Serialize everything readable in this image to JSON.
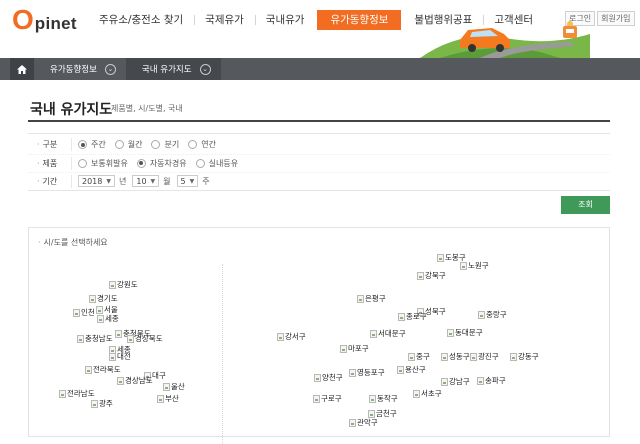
{
  "header": {
    "logo_initial": "O",
    "logo_rest": "pinet",
    "nav": [
      {
        "label": "주유소/충전소 찾기",
        "active": false
      },
      {
        "label": "국제유가",
        "active": false
      },
      {
        "label": "국내유가",
        "active": false
      },
      {
        "label": "유가동향정보",
        "active": true
      },
      {
        "label": "불법행위공표",
        "active": false
      },
      {
        "label": "고객센터",
        "active": false
      }
    ],
    "login": "로그인",
    "join": "회원가입"
  },
  "breadcrumb": {
    "items": [
      "유가동향정보",
      "국내 유가지도"
    ]
  },
  "page": {
    "title": "국내 유가지도",
    "subtitle": "제품별, 시/도별, 국내"
  },
  "form": {
    "period": {
      "label": "구분",
      "options": [
        {
          "label": "주간",
          "checked": true
        },
        {
          "label": "월간",
          "checked": false
        },
        {
          "label": "분기",
          "checked": false
        },
        {
          "label": "연간",
          "checked": false
        }
      ]
    },
    "product": {
      "label": "제품",
      "options": [
        {
          "label": "보통휘발유",
          "checked": false
        },
        {
          "label": "자동차경유",
          "checked": true
        },
        {
          "label": "실내등유",
          "checked": false
        }
      ]
    },
    "date": {
      "label": "기간",
      "year": "2018",
      "year_unit": "년",
      "month": "10",
      "month_unit": "월",
      "week": "5",
      "week_unit": "주"
    },
    "search_button": "조회"
  },
  "map": {
    "hint": "시/도를 선택하세요",
    "left_markers": [
      {
        "label": "강원도"
      },
      {
        "label": "경기도"
      },
      {
        "label": "서울"
      },
      {
        "label": "인천"
      },
      {
        "label": "세종"
      },
      {
        "label": "충청남도"
      },
      {
        "label": "충청북도"
      },
      {
        "label": "경상북도"
      },
      {
        "label": "세종"
      },
      {
        "label": "대전"
      },
      {
        "label": "전라북도"
      },
      {
        "label": "대구"
      },
      {
        "label": "경상남도"
      },
      {
        "label": "울산"
      },
      {
        "label": "전라남도"
      },
      {
        "label": "부산"
      },
      {
        "label": "광주"
      }
    ],
    "right_markers": [
      {
        "label": "도봉구"
      },
      {
        "label": "노원구"
      },
      {
        "label": "강북구"
      },
      {
        "label": "은평구"
      },
      {
        "label": "성북구"
      },
      {
        "label": "종로구"
      },
      {
        "label": "중랑구"
      },
      {
        "label": "강서구"
      },
      {
        "label": "서대문구"
      },
      {
        "label": "동대문구"
      },
      {
        "label": "마포구"
      },
      {
        "label": "중구"
      },
      {
        "label": "성동구"
      },
      {
        "label": "광진구"
      },
      {
        "label": "강동구"
      },
      {
        "label": "양천구"
      },
      {
        "label": "영등포구"
      },
      {
        "label": "용산구"
      },
      {
        "label": "구로구"
      },
      {
        "label": "동작구"
      },
      {
        "label": "강남구"
      },
      {
        "label": "송파구"
      },
      {
        "label": "서초구"
      },
      {
        "label": "금천구"
      },
      {
        "label": "관악구"
      }
    ]
  }
}
